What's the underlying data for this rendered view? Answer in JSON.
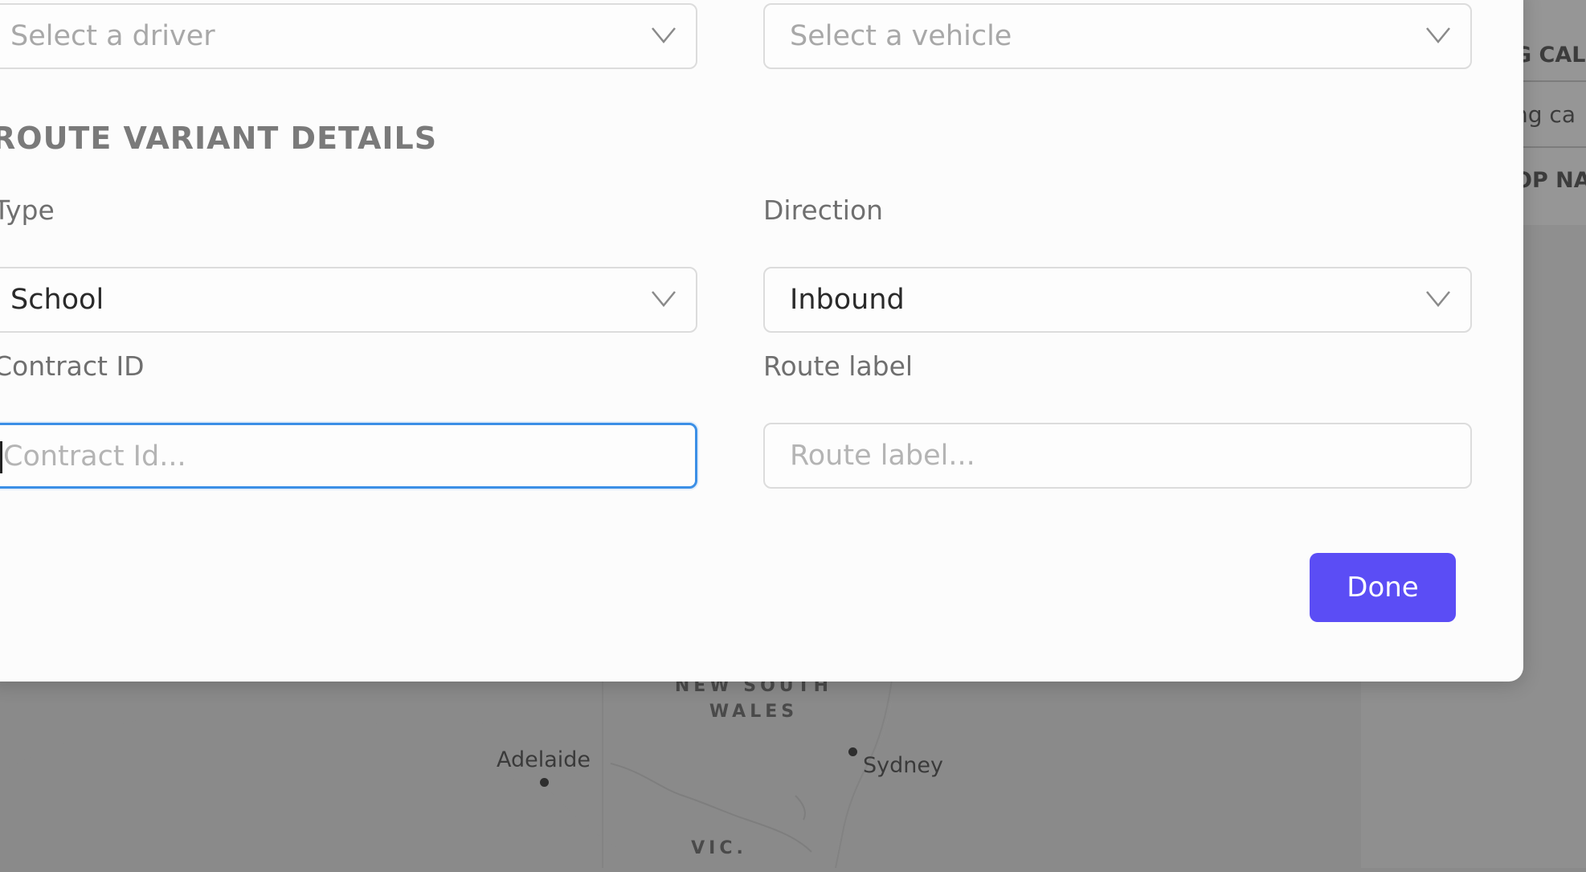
{
  "assignment": {
    "driver_select": {
      "placeholder": "Select a driver"
    },
    "vehicle_select": {
      "placeholder": "Select a vehicle"
    }
  },
  "route_variant": {
    "section_title": "ROUTE VARIANT DETAILS",
    "type": {
      "label": "Type",
      "value": "School"
    },
    "direction": {
      "label": "Direction",
      "value": "Inbound"
    },
    "contract_id": {
      "label": "Contract ID",
      "placeholder": "Contract Id..."
    },
    "route_label": {
      "label": "Route label",
      "placeholder": "Route label..."
    }
  },
  "actions": {
    "done_label": "Done"
  },
  "background": {
    "map": {
      "region_label": "NEW SOUTH\nWALES",
      "region_short": "VIC.",
      "cities": [
        "Adelaide",
        "Sydney"
      ]
    },
    "side_panel": {
      "rows": [
        "G CAL",
        "ng ca",
        "OP NA"
      ]
    }
  },
  "colors": {
    "primary_button": "#5b4df5",
    "focus_ring": "#3b8fe6",
    "overlay": "#8a8a8a"
  }
}
